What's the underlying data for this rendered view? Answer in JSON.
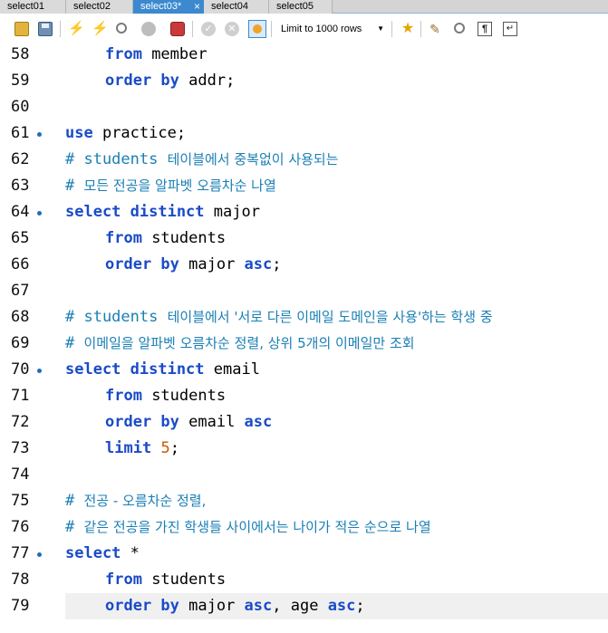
{
  "tabs": [
    {
      "label": "select01",
      "active": false
    },
    {
      "label": "select02",
      "active": false
    },
    {
      "label": "select03*",
      "active": true
    },
    {
      "label": "select04",
      "active": false
    },
    {
      "label": "select05",
      "active": false
    }
  ],
  "tab_close_glyph": "×",
  "toolbar": {
    "limit_label": "Limit to 1000 rows",
    "icons": [
      "open-folder-icon",
      "save-icon",
      "execute-icon",
      "execute-current-icon",
      "explain-icon",
      "stop-icon",
      "toggle-error-icon",
      "commit-icon",
      "rollback-icon",
      "autocommit-icon",
      "bookmark-icon",
      "beautify-icon",
      "find-icon",
      "invisible-chars-icon",
      "word-wrap-icon"
    ]
  },
  "colors": {
    "keyword": "#1a4bc7",
    "comment": "#1a7fb4",
    "number": "#c45a00",
    "active_tab": "#3c89d0"
  },
  "editor": {
    "lines": [
      {
        "n": "58",
        "tokens": [
          {
            "t": "from",
            "k": "kw"
          },
          {
            "t": " member",
            "k": ""
          }
        ],
        "indent": true
      },
      {
        "n": "59",
        "tokens": [
          {
            "t": "order by",
            "k": "kw"
          },
          {
            "t": " addr;",
            "k": ""
          }
        ],
        "indent": true
      },
      {
        "n": "60",
        "tokens": []
      },
      {
        "n": "61",
        "marker": true,
        "tokens": [
          {
            "t": "use",
            "k": "kw"
          },
          {
            "t": " practice;",
            "k": ""
          }
        ]
      },
      {
        "n": "62",
        "tokens": [
          {
            "t": "# students ",
            "k": "cm"
          },
          {
            "t": "테이블에서 중복없이 사용되는",
            "k": "cm-ko"
          }
        ]
      },
      {
        "n": "63",
        "tokens": [
          {
            "t": "# ",
            "k": "cm"
          },
          {
            "t": "모든 전공을 알파벳 오름차순 나열",
            "k": "cm-ko"
          }
        ]
      },
      {
        "n": "64",
        "marker": true,
        "tokens": [
          {
            "t": "select distinct",
            "k": "kw"
          },
          {
            "t": " major",
            "k": ""
          }
        ]
      },
      {
        "n": "65",
        "tokens": [
          {
            "t": "from",
            "k": "kw"
          },
          {
            "t": " students",
            "k": ""
          }
        ],
        "indent": true
      },
      {
        "n": "66",
        "tokens": [
          {
            "t": "order by",
            "k": "kw"
          },
          {
            "t": " major ",
            "k": ""
          },
          {
            "t": "asc",
            "k": "kw"
          },
          {
            "t": ";",
            "k": ""
          }
        ],
        "indent": true
      },
      {
        "n": "67",
        "tokens": []
      },
      {
        "n": "68",
        "tokens": [
          {
            "t": "# students ",
            "k": "cm"
          },
          {
            "t": "테이블에서 '서로 다른 이메일 도메인을 사용'하는 학생 중",
            "k": "cm-ko"
          }
        ]
      },
      {
        "n": "69",
        "tokens": [
          {
            "t": "# ",
            "k": "cm"
          },
          {
            "t": "이메일을 알파벳 오름차순 정렬, 상위 5개의 이메일만 조회",
            "k": "cm-ko"
          }
        ]
      },
      {
        "n": "70",
        "marker": true,
        "tokens": [
          {
            "t": "select distinct",
            "k": "kw"
          },
          {
            "t": " email",
            "k": ""
          }
        ]
      },
      {
        "n": "71",
        "tokens": [
          {
            "t": "from",
            "k": "kw"
          },
          {
            "t": " students",
            "k": ""
          }
        ],
        "indent": true
      },
      {
        "n": "72",
        "tokens": [
          {
            "t": "order by",
            "k": "kw"
          },
          {
            "t": " email ",
            "k": ""
          },
          {
            "t": "asc",
            "k": "kw"
          }
        ],
        "indent": true
      },
      {
        "n": "73",
        "tokens": [
          {
            "t": "limit",
            "k": "kw"
          },
          {
            "t": " ",
            "k": ""
          },
          {
            "t": "5",
            "k": "num"
          },
          {
            "t": ";",
            "k": ""
          }
        ],
        "indent": true
      },
      {
        "n": "74",
        "tokens": []
      },
      {
        "n": "75",
        "tokens": [
          {
            "t": "# ",
            "k": "cm"
          },
          {
            "t": "전공 - 오름차순 정렬,",
            "k": "cm-ko"
          }
        ]
      },
      {
        "n": "76",
        "tokens": [
          {
            "t": "# ",
            "k": "cm"
          },
          {
            "t": "같은 전공을 가진 학생들 사이에서는 나이가 적은 순으로 나열",
            "k": "cm-ko"
          }
        ]
      },
      {
        "n": "77",
        "marker": true,
        "tokens": [
          {
            "t": "select",
            "k": "kw"
          },
          {
            "t": " *",
            "k": ""
          }
        ]
      },
      {
        "n": "78",
        "tokens": [
          {
            "t": "from",
            "k": "kw"
          },
          {
            "t": " students",
            "k": ""
          }
        ],
        "indent": true
      },
      {
        "n": "79",
        "current": true,
        "tokens": [
          {
            "t": "order by",
            "k": "kw"
          },
          {
            "t": " major ",
            "k": ""
          },
          {
            "t": "asc",
            "k": "kw"
          },
          {
            "t": ", age ",
            "k": ""
          },
          {
            "t": "asc",
            "k": "kw"
          },
          {
            "t": ";",
            "k": ""
          }
        ],
        "indent": true
      }
    ]
  }
}
